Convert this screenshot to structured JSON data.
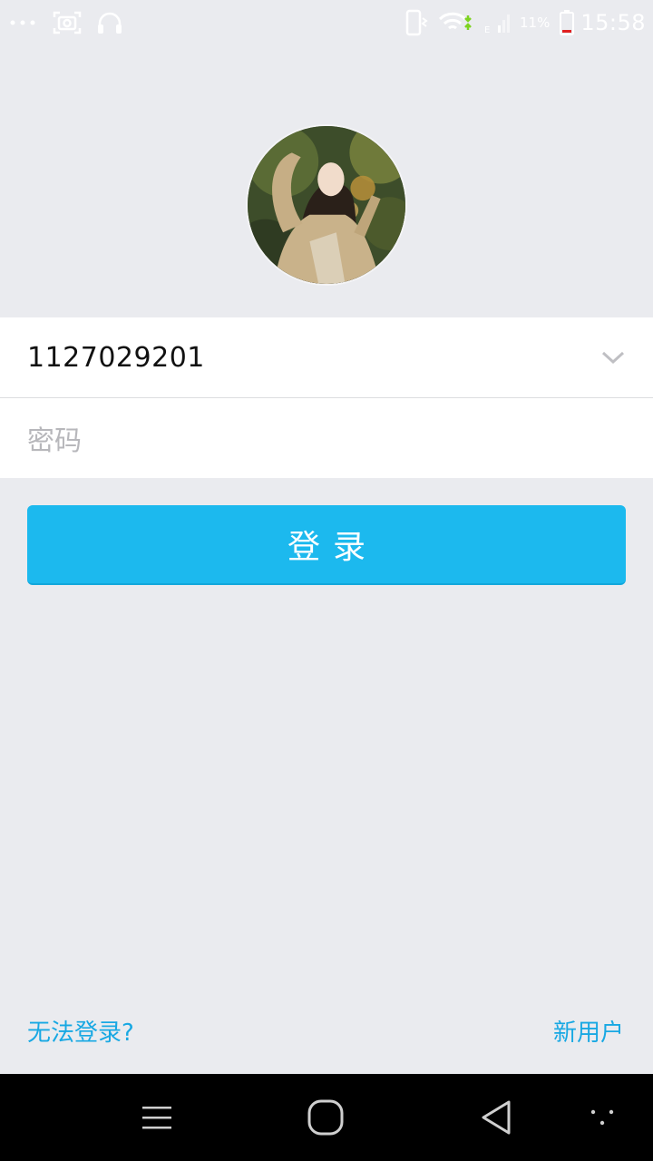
{
  "status_bar": {
    "battery_percent": "11%",
    "time": "15:58",
    "icons": [
      "more-dots-icon",
      "screenshot-icon",
      "headphones-icon",
      "vibrate-icon",
      "wifi-icon",
      "cell-signal-icon",
      "battery-icon"
    ]
  },
  "login": {
    "account": "1127029201",
    "password_placeholder": "密码",
    "login_label": "登录",
    "cant_login_label": "无法登录?",
    "new_user_label": "新用户"
  },
  "colors": {
    "background": "#eaebef",
    "accent": "#1cb9ee",
    "link": "#18a8e3"
  },
  "nav_bar": {
    "icons": [
      "menu-icon",
      "home-icon",
      "back-icon",
      "more-icon"
    ]
  }
}
